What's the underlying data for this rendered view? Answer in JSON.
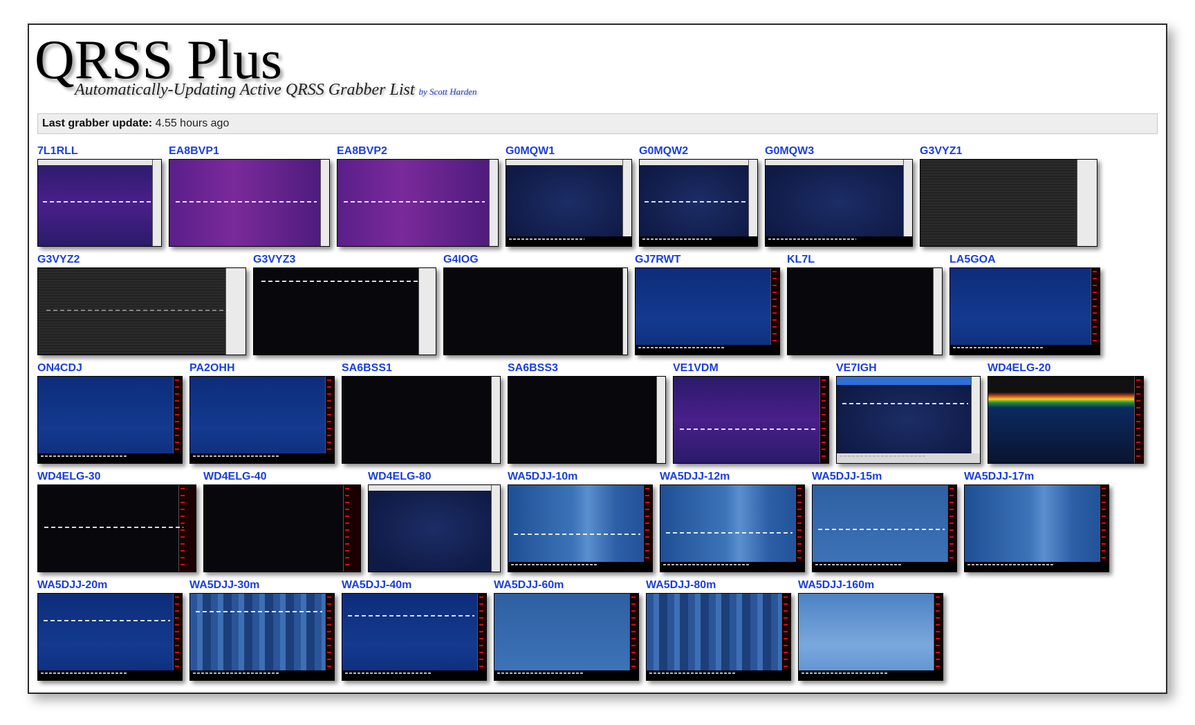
{
  "header": {
    "title": "QRSS Plus",
    "subtitle": "Automatically-Updating Active QRSS Grabber List",
    "by": "by",
    "author": "Scott Harden"
  },
  "status": {
    "label": "Last grabber update:",
    "value": "4.55 hours ago"
  },
  "grabbers": {
    "row1": [
      {
        "call": "7L1RLL",
        "style": "purple"
      },
      {
        "call": "EA8BVP1",
        "style": "magenta"
      },
      {
        "call": "EA8BVP2",
        "style": "magenta"
      },
      {
        "call": "G0MQW1",
        "style": "navy"
      },
      {
        "call": "G0MQW2",
        "style": "navy"
      },
      {
        "call": "G0MQW3",
        "style": "navy"
      },
      {
        "call": "G3VYZ1",
        "style": "gray"
      }
    ],
    "row2": [
      {
        "call": "G3VYZ2",
        "style": "gray"
      },
      {
        "call": "G3VYZ3",
        "style": "black"
      },
      {
        "call": "G4IOG",
        "style": "black"
      },
      {
        "call": "GJ7RWT",
        "style": "blue"
      },
      {
        "call": "KL7L",
        "style": "black"
      },
      {
        "call": "LA5GOA",
        "style": "blue"
      }
    ],
    "row3": [
      {
        "call": "ON4CDJ",
        "style": "blue"
      },
      {
        "call": "PA2OHH",
        "style": "blue"
      },
      {
        "call": "SA6BSS1",
        "style": "black"
      },
      {
        "call": "SA6BSS3",
        "style": "black"
      },
      {
        "call": "VE1VDM",
        "style": "purple"
      },
      {
        "call": "VE7IGH",
        "style": "navy"
      },
      {
        "call": "WD4ELG-20",
        "style": "thermal"
      }
    ],
    "row4": [
      {
        "call": "WD4ELG-30",
        "style": "black"
      },
      {
        "call": "WD4ELG-40",
        "style": "black"
      },
      {
        "call": "WD4ELG-80",
        "style": "navy"
      },
      {
        "call": "WA5DJJ-10m",
        "style": "light"
      },
      {
        "call": "WA5DJJ-12m",
        "style": "light"
      },
      {
        "call": "WA5DJJ-15m",
        "style": "sky"
      },
      {
        "call": "WA5DJJ-17m",
        "style": "light"
      }
    ],
    "row5": [
      {
        "call": "WA5DJJ-20m",
        "style": "blue"
      },
      {
        "call": "WA5DJJ-30m",
        "style": "stripes"
      },
      {
        "call": "WA5DJJ-40m",
        "style": "blue"
      },
      {
        "call": "WA5DJJ-60m",
        "style": "sky"
      },
      {
        "call": "WA5DJJ-80m",
        "style": "stripes"
      },
      {
        "call": "WA5DJJ-160m",
        "style": "pale"
      }
    ]
  }
}
